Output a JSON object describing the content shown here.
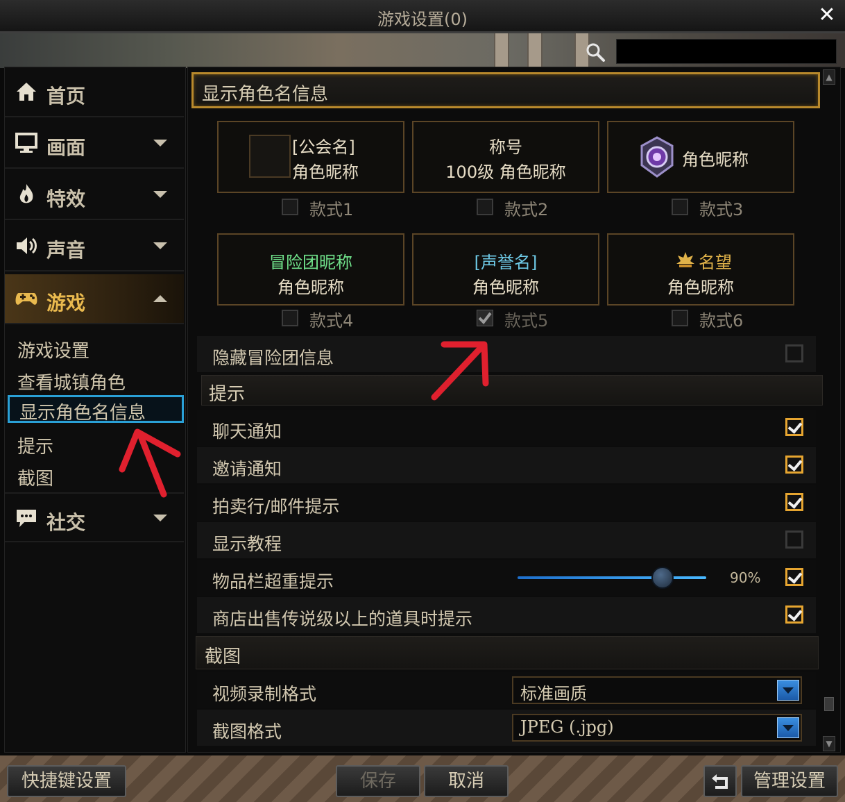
{
  "window": {
    "title": "游戏设置(0)"
  },
  "search": {
    "placeholder": "",
    "value": ""
  },
  "sidebar": {
    "items": [
      {
        "label": "首页",
        "icon": "home-icon"
      },
      {
        "label": "画面",
        "icon": "monitor-icon"
      },
      {
        "label": "特效",
        "icon": "flame-icon"
      },
      {
        "label": "声音",
        "icon": "speaker-icon"
      },
      {
        "label": "游戏",
        "icon": "gamepad-icon"
      },
      {
        "label": "社交",
        "icon": "chat-icon"
      }
    ],
    "sub_items": [
      "游戏设置",
      "查看城镇角色",
      "显示角色名信息",
      "提示",
      "截图"
    ]
  },
  "sections": {
    "name_display": "显示角色名信息",
    "hints": "提示",
    "screenshot": "截图"
  },
  "name_styles": [
    {
      "line1": "[公会名]",
      "line2": "角色昵称",
      "option": "款式1",
      "checked": false
    },
    {
      "line1": "称号",
      "line2": "100级 角色昵称",
      "option": "款式2",
      "checked": false
    },
    {
      "line1": "角色昵称",
      "line2": "",
      "option": "款式3",
      "checked": false
    },
    {
      "line1": "冒险团昵称",
      "line2": "角色昵称",
      "option": "款式4",
      "checked": false
    },
    {
      "line1": "[声誉名]",
      "line2": "角色昵称",
      "option": "款式5",
      "checked": true
    },
    {
      "line1": "名望",
      "line2": "角色昵称",
      "option": "款式6",
      "checked": false
    }
  ],
  "options": {
    "hide_adventure_group": {
      "label": "隐藏冒险团信息",
      "checked": false
    },
    "chat_notify": {
      "label": "聊天通知",
      "checked": true
    },
    "invite_notify": {
      "label": "邀请通知",
      "checked": true
    },
    "auction_mail": {
      "label": "拍卖行/邮件提示",
      "checked": true
    },
    "show_tutorial": {
      "label": "显示教程",
      "checked": false
    },
    "overweight": {
      "label": "物品栏超重提示",
      "checked": true,
      "value_text": "90%",
      "value": 0.9
    },
    "shop_legendary": {
      "label": "商店出售传说级以上的道具时提示",
      "checked": true
    }
  },
  "screenshot_settings": {
    "video_format": {
      "label": "视频录制格式",
      "value": "标准画质"
    },
    "image_format": {
      "label": "截图格式",
      "value": "JPEG (.jpg)"
    }
  },
  "buttons": {
    "shortcut": "快捷键设置",
    "save": "保存",
    "cancel": "取消",
    "manage": "管理设置"
  },
  "colors": {
    "accent_gold": "#e6a530",
    "selection_blue": "#2aa0d6",
    "adventure_green": "#6fe08a",
    "reputation_teal": "#6ec9e6",
    "fame_gold": "#e0b24a",
    "annotation_red": "#e0202e"
  }
}
